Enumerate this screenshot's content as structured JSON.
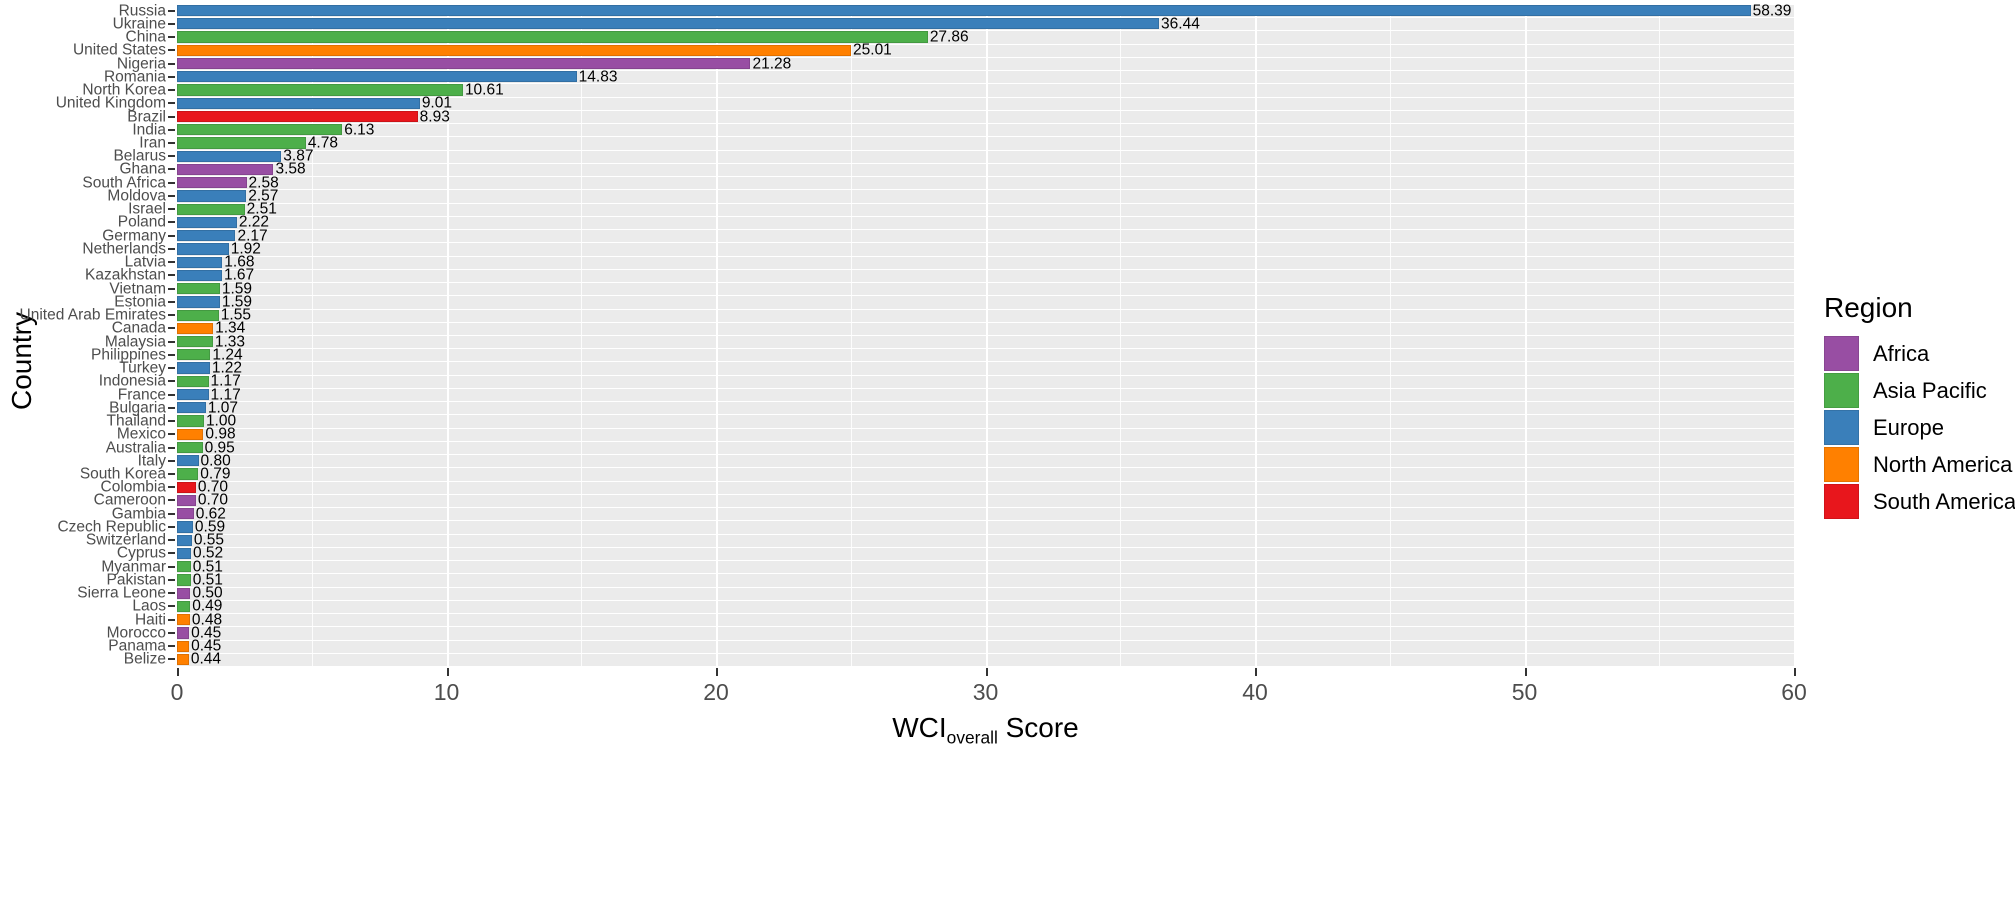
{
  "chart_data": {
    "type": "bar",
    "orientation": "horizontal",
    "title": "",
    "xlabel": "WCI_overall Score",
    "xlabel_parts": {
      "base": "WCI",
      "sub": "overall",
      "tail": " Score"
    },
    "ylabel": "Country",
    "xlim": [
      0,
      60
    ],
    "xticks": [
      0,
      10,
      20,
      30,
      40,
      50,
      60
    ],
    "xtick_labels": [
      "0",
      "10",
      "20",
      "30",
      "40",
      "50",
      "60"
    ],
    "xminor_ticks": [
      5,
      15,
      25,
      35,
      45,
      55
    ],
    "grid": "on",
    "legend_position": "right",
    "legend_title": "Region",
    "legend_entries": [
      {
        "label": "Africa",
        "color": "#984ea3"
      },
      {
        "label": "Asia Pacific",
        "color": "#4daf4a"
      },
      {
        "label": "Europe",
        "color": "#3a7fba"
      },
      {
        "label": "North America",
        "color": "#ff8000"
      },
      {
        "label": "South America",
        "color": "#e8161c"
      }
    ],
    "region_colors": {
      "Africa": "#984ea3",
      "Asia Pacific": "#4daf4a",
      "Europe": "#3a7fba",
      "North America": "#ff8000",
      "South America": "#e8161c"
    },
    "categories": [
      "Russia",
      "Ukraine",
      "China",
      "United States",
      "Nigeria",
      "Romania",
      "North Korea",
      "United Kingdom",
      "Brazil",
      "India",
      "Iran",
      "Belarus",
      "Ghana",
      "South Africa",
      "Moldova",
      "Israel",
      "Poland",
      "Germany",
      "Netherlands",
      "Latvia",
      "Kazakhstan",
      "Vietnam",
      "Estonia",
      "United Arab Emirates",
      "Canada",
      "Malaysia",
      "Philippines",
      "Turkey",
      "Indonesia",
      "France",
      "Bulgaria",
      "Thailand",
      "Mexico",
      "Australia",
      "Italy",
      "South Korea",
      "Colombia",
      "Cameroon",
      "Gambia",
      "Czech Republic",
      "Switzerland",
      "Cyprus",
      "Myanmar",
      "Pakistan",
      "Sierra Leone",
      "Laos",
      "Haiti",
      "Morocco",
      "Panama",
      "Belize"
    ],
    "values": [
      58.39,
      36.44,
      27.86,
      25.01,
      21.28,
      14.83,
      10.61,
      9.01,
      8.93,
      6.13,
      4.78,
      3.87,
      3.58,
      2.58,
      2.57,
      2.51,
      2.22,
      2.17,
      1.92,
      1.68,
      1.67,
      1.59,
      1.59,
      1.55,
      1.34,
      1.33,
      1.24,
      1.22,
      1.17,
      1.17,
      1.07,
      1.0,
      0.98,
      0.95,
      0.8,
      0.79,
      0.7,
      0.7,
      0.62,
      0.59,
      0.55,
      0.52,
      0.51,
      0.51,
      0.5,
      0.49,
      0.48,
      0.45,
      0.45,
      0.44
    ],
    "value_labels": [
      "58.39",
      "36.44",
      "27.86",
      "25.01",
      "21.28",
      "14.83",
      "10.61",
      "9.01",
      "8.93",
      "6.13",
      "4.78",
      "3.87",
      "3.58",
      "2.58",
      "2.57",
      "2.51",
      "2.22",
      "2.17",
      "1.92",
      "1.68",
      "1.67",
      "1.59",
      "1.59",
      "1.55",
      "1.34",
      "1.33",
      "1.24",
      "1.22",
      "1.17",
      "1.17",
      "1.07",
      "1.00",
      "0.98",
      "0.95",
      "0.80",
      "0.79",
      "0.70",
      "0.70",
      "0.62",
      "0.59",
      "0.55",
      "0.52",
      "0.51",
      "0.51",
      "0.50",
      "0.49",
      "0.48",
      "0.45",
      "0.45",
      "0.44"
    ],
    "regions": [
      "Europe",
      "Europe",
      "Asia Pacific",
      "North America",
      "Africa",
      "Europe",
      "Asia Pacific",
      "Europe",
      "South America",
      "Asia Pacific",
      "Asia Pacific",
      "Europe",
      "Africa",
      "Africa",
      "Europe",
      "Asia Pacific",
      "Europe",
      "Europe",
      "Europe",
      "Europe",
      "Europe",
      "Asia Pacific",
      "Europe",
      "Asia Pacific",
      "North America",
      "Asia Pacific",
      "Asia Pacific",
      "Europe",
      "Asia Pacific",
      "Europe",
      "Europe",
      "Asia Pacific",
      "North America",
      "Asia Pacific",
      "Europe",
      "Asia Pacific",
      "South America",
      "Africa",
      "Africa",
      "Europe",
      "Europe",
      "Europe",
      "Asia Pacific",
      "Asia Pacific",
      "Africa",
      "Asia Pacific",
      "North America",
      "Africa",
      "North America",
      "North America"
    ]
  }
}
